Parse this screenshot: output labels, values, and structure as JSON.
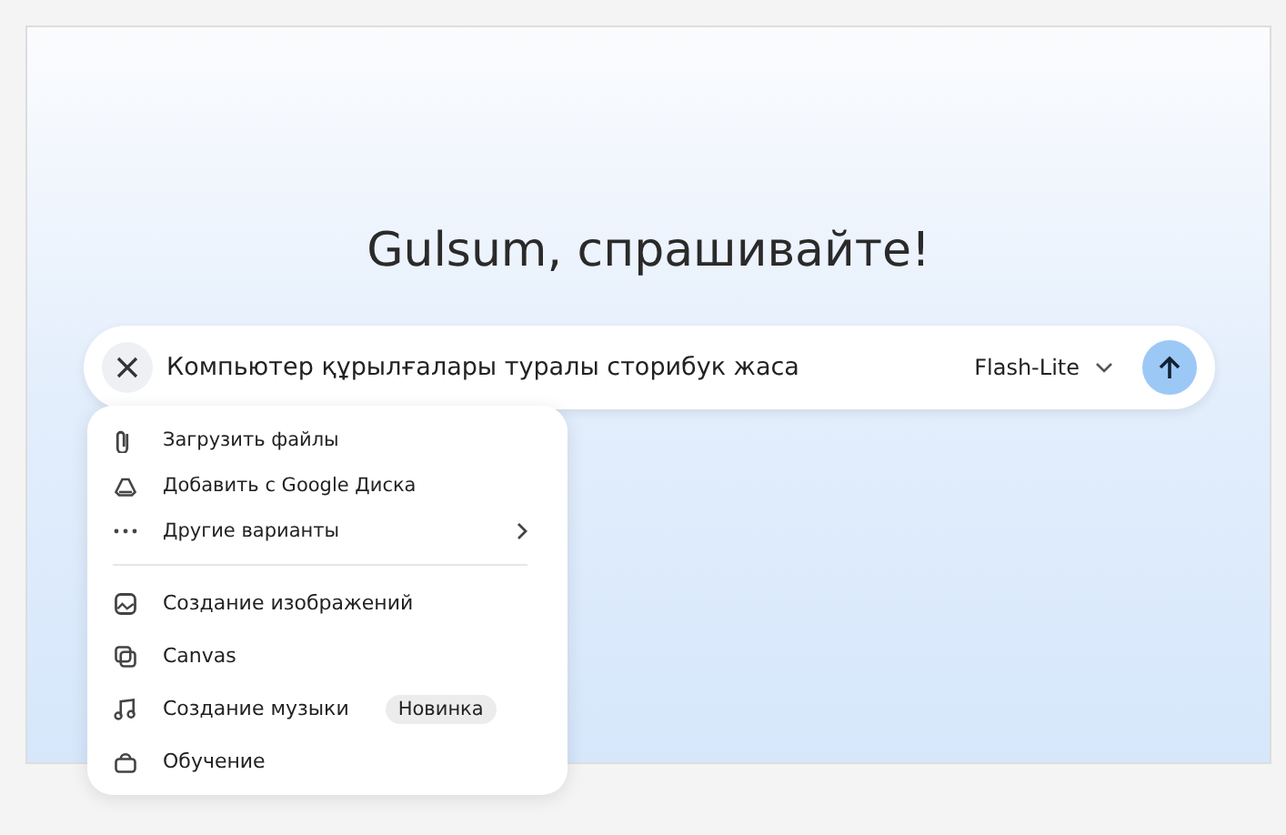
{
  "heading": "Gulsum, спрашивайте!",
  "prompt": {
    "value": "Компьютер құрылғалары туралы сторибук жаса",
    "model": "Flash-Lite"
  },
  "menu": {
    "sections": [
      [
        {
          "label": "Загрузить файлы",
          "submenu": false
        },
        {
          "label": "Добавить с Google Диска",
          "submenu": false
        },
        {
          "label": "Другие варианты",
          "submenu": true
        }
      ],
      [
        {
          "label": "Создание изображений",
          "submenu": false
        },
        {
          "label": "Canvas",
          "submenu": false
        },
        {
          "label": "Создание музыки",
          "badge": "Новинка",
          "submenu": false
        },
        {
          "label": "Обучение",
          "submenu": false
        }
      ]
    ]
  }
}
